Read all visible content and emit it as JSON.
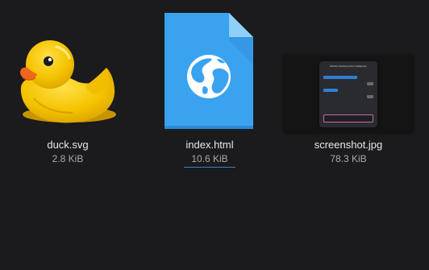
{
  "files": [
    {
      "name": "duck.svg",
      "size": "2.8 KiB",
      "icon": "rubber-duck-icon",
      "colors": {
        "body": "#f5c400",
        "shade": "#d9a300",
        "beak": "#f0651d"
      }
    },
    {
      "name": "index.html",
      "size": "10.6 KiB",
      "icon": "html-document-globe-icon",
      "focused": true,
      "colors": {
        "page": "#3aa3f0",
        "fold": "#8fd0f7",
        "globe": "#ffffff"
      }
    },
    {
      "name": "screenshot.jpg",
      "size": "78.3 KiB",
      "icon": "image-thumbnail",
      "thumbnail": {
        "title": "Rubber Ducking Actor Intelligence"
      }
    }
  ],
  "theme": {
    "background": "#1b1b1d",
    "name_color": "#e8e8e8",
    "size_color": "#a9a9a9",
    "focus_underline": "#3d7fbf"
  }
}
